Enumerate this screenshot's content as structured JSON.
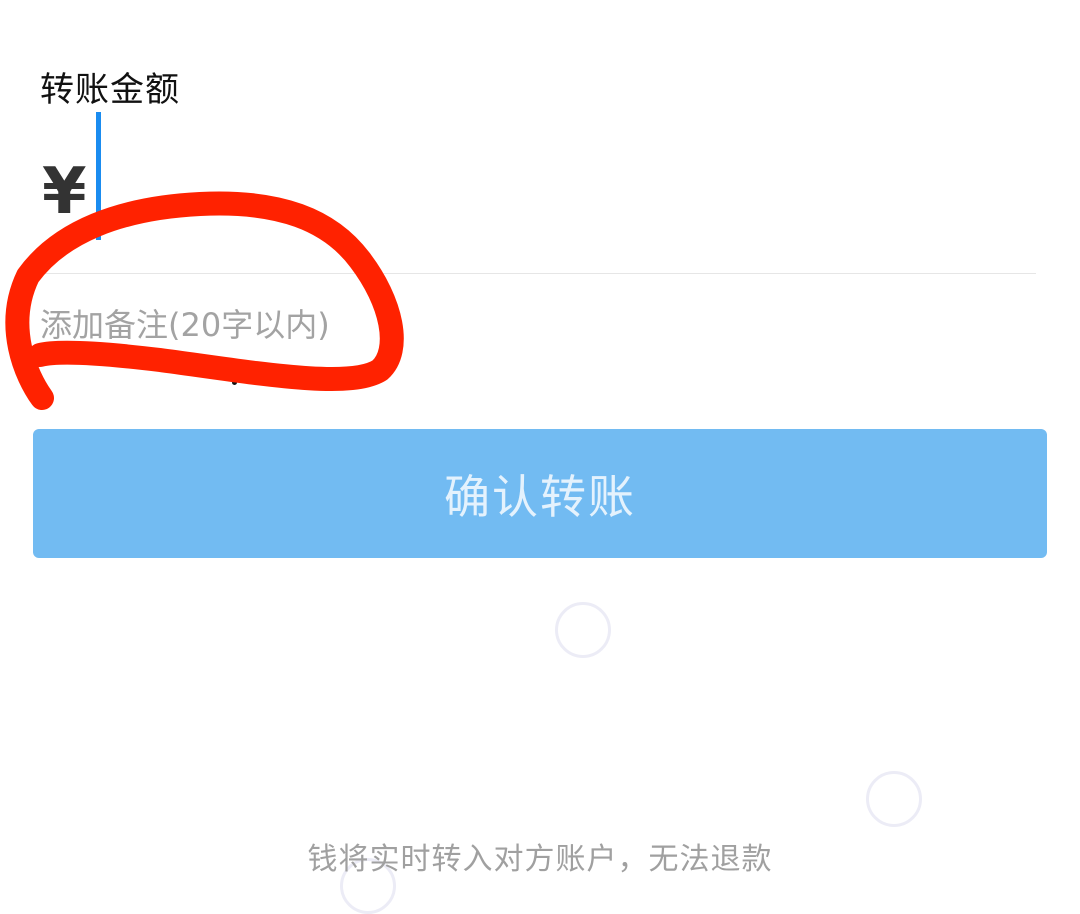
{
  "amount": {
    "label": "转账金额",
    "currency_symbol": "¥",
    "value": ""
  },
  "remark": {
    "link_text": "添加备注(20字以内)"
  },
  "confirm_button": {
    "label": "确认转账"
  },
  "footer": {
    "notice": "钱将实时转入对方账户，无法退款"
  },
  "colors": {
    "caret": "#1a8cf0",
    "button_bg": "#72bbf2",
    "annotation_stroke": "#ff2200"
  }
}
